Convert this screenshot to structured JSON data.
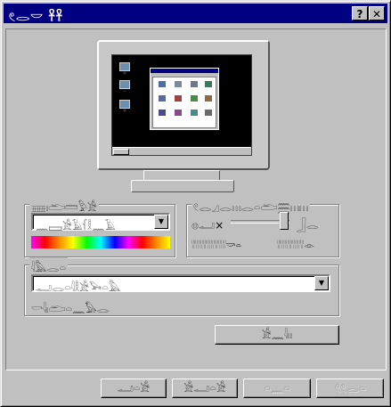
{
  "window": {
    "title": "𓏲𓂋𓎟 𓋹𓋹",
    "help_label": "?",
    "close_label": "✕"
  },
  "desktop_preview": {
    "icons": [
      "𓂀",
      "𓊖",
      "𓂀"
    ],
    "mini_icons": [
      "𓊖",
      "𓊖",
      "𓊖",
      "𓊖",
      "𓊖",
      "𓊖",
      "𓊖",
      "𓊖",
      "𓊖",
      "𓊖",
      "𓊖",
      "𓊖"
    ]
  },
  "background_group": {
    "label": "𓈈𓏤𓂧𓏠𓅱𓀀",
    "combo_value": "𓈖𓈙𓀀𓄿𓆳𓎛𓈖𓄿",
    "combo_arrow": "▼"
  },
  "slider_group": {
    "label": "𓏲𓂋𓈎𓂋𓏥𓂋𓏏𓂧𓈗𓏥𓏥",
    "left_glyph": "𓊖𓂝×",
    "right_glyph": "𓃀𓂋",
    "bottom_left": "𓏾𓏾𓏾𓏾𓏾𓏾𓏾𓏾𓏾𓎡𓏏",
    "bottom_right": "𓏾𓏾𓏾𓏾𓏾𓏾𓏾𓁹"
  },
  "scheme_group": {
    "label": "𓇋𓅓𓂋𓏏",
    "combo_value": "𓂝𓂋𓏏𓇋𓎛𓀀𓅨𓏏𓅓",
    "combo_arrow": "▼",
    "footer": "𓎡𓇋𓏤𓂧𓏏𓈖𓅃𓂋"
  },
  "settings_button": "𓀀𓈖𓇋𓏤𓏤",
  "buttons": {
    "ok": "𓂝𓏏𓀀",
    "cancel": "𓀀𓂝𓏏𓀀",
    "apply": "𓏏𓈖𓏏",
    "help": "𓏲𓏲𓂋𓏏"
  }
}
